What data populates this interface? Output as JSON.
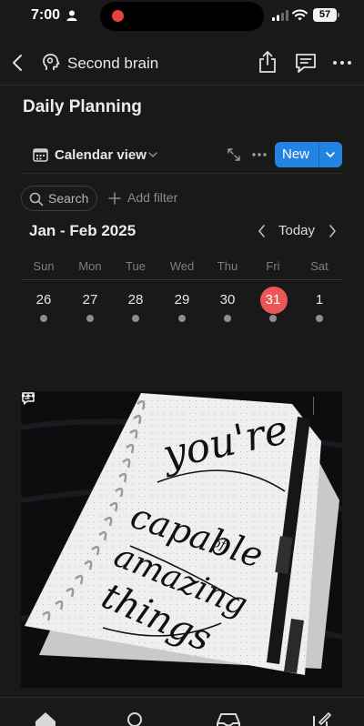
{
  "status_bar": {
    "time": "7:00",
    "battery": "57",
    "icons": [
      "person-icon",
      "recording-dot",
      "signal-icon",
      "wifi-icon",
      "battery-icon"
    ]
  },
  "nav": {
    "title": "Second brain",
    "icons": [
      "back-icon",
      "brain-icon",
      "share-icon",
      "comment-icon",
      "more-icon"
    ]
  },
  "page": {
    "title": "Daily Planning"
  },
  "toolbar": {
    "view_label": "Calendar view",
    "new_label": "New",
    "icons": [
      "calendar-icon",
      "chevron-down-icon",
      "expand-icon",
      "more-icon"
    ]
  },
  "filters": {
    "search_label": "Search",
    "add_filter_label": "Add filter"
  },
  "calendar": {
    "range": "Jan - Feb 2025",
    "today_label": "Today",
    "weekdays": [
      "Sun",
      "Mon",
      "Tue",
      "Wed",
      "Thu",
      "Fri",
      "Sat"
    ],
    "dates": [
      "26",
      "27",
      "28",
      "29",
      "30",
      "31",
      "1"
    ],
    "today_index": 5
  },
  "card": {
    "image_text": [
      "you're",
      "capable",
      "of",
      "amazing",
      "things"
    ]
  },
  "tabbar": {
    "icons": [
      "home-icon",
      "search-icon",
      "inbox-icon",
      "compose-icon"
    ]
  },
  "colors": {
    "background": "#191919",
    "accent": "#2383e2",
    "today": "#eb5757",
    "text": "#e6e6e6",
    "muted": "#7f7f7f"
  }
}
